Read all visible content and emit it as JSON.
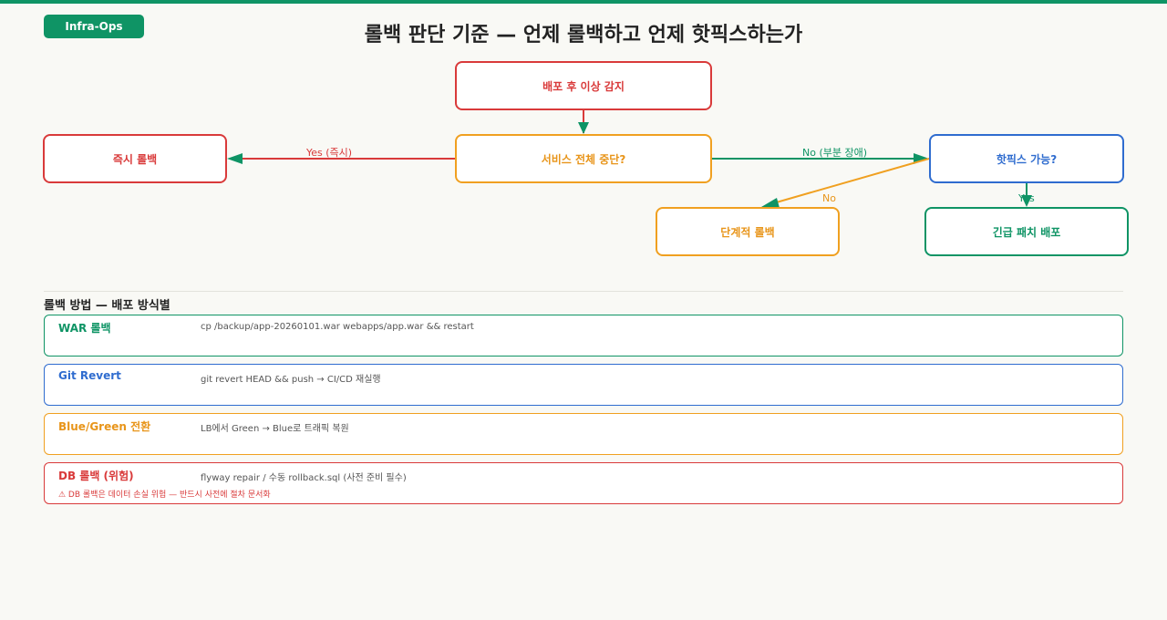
{
  "header": {
    "tag": "Infra-Ops",
    "title": "롤백 판단 기준 — 언제 롤백하고 언제 핫픽스하는가"
  },
  "colors": {
    "red": "#d93a3a",
    "orange": "#f0a020",
    "blue": "#2f6ccf",
    "green": "#0f9465"
  },
  "flow": {
    "nodes": {
      "detect": "배포 후 이상 감지",
      "outage": "서비스 전체 중단?",
      "rollback_now": "즉시 롤백",
      "hotfix_possible": "핫픽스 가능?",
      "staged_rollback": "단계적 롤백",
      "emergency_patch": "긴급 패치 배포"
    },
    "edges": {
      "yes_immediate": "Yes (즉시)",
      "no_partial": "No (부분 장애)",
      "no": "No",
      "yes": "Yes"
    }
  },
  "methods": {
    "title": "롤백 방법 — 배포 방식별",
    "items": [
      {
        "name": "WAR 롤백",
        "cmd": "cp /backup/app-20260101.war webapps/app.war && restart",
        "warn": ""
      },
      {
        "name": "Git Revert",
        "cmd": "git revert HEAD && push → CI/CD 재실행",
        "warn": ""
      },
      {
        "name": "Blue/Green 전환",
        "cmd": "LB에서 Green → Blue로 트래픽 복원",
        "warn": ""
      },
      {
        "name": "DB 롤백 (위험)",
        "cmd": "flyway repair / 수동 rollback.sql (사전 준비 필수)",
        "warn": "⚠ DB 롤백은 데이터 손실 위험 — 반드시 사전에 절차 문서화"
      }
    ]
  }
}
